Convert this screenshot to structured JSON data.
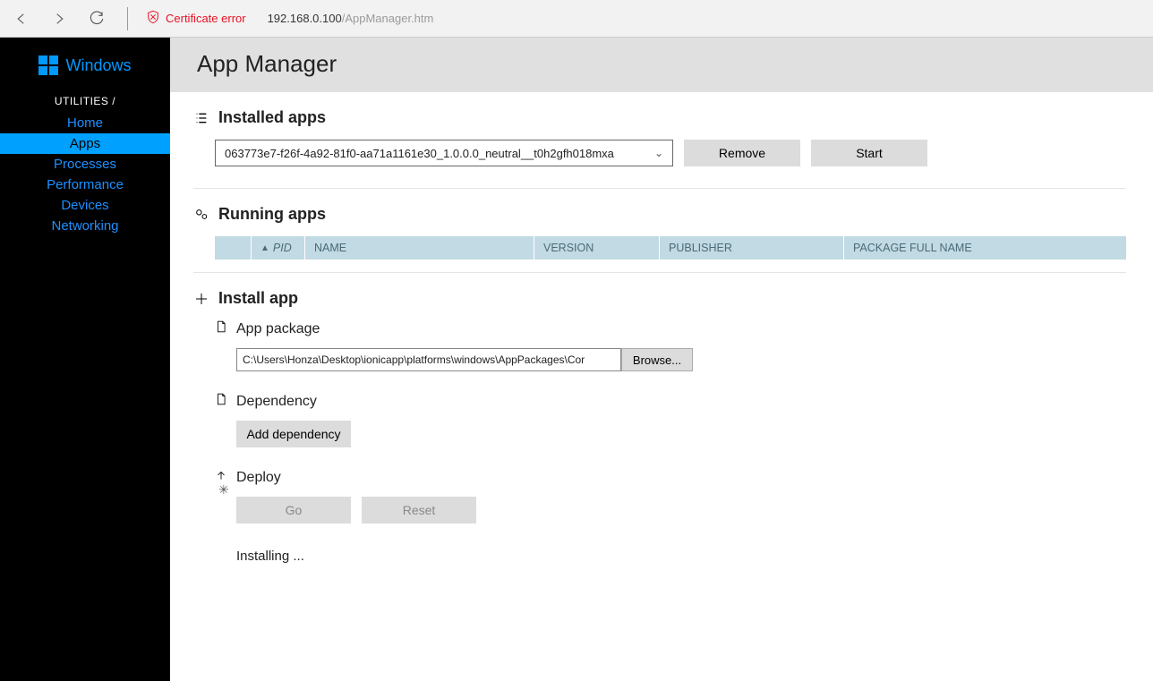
{
  "browser": {
    "cert_error": "Certificate error",
    "url_host": "192.168.0.100",
    "url_path": "/AppManager.htm"
  },
  "sidebar": {
    "logo_text": "Windows",
    "heading": "UTILITIES /",
    "items": [
      {
        "label": "Home"
      },
      {
        "label": "Apps"
      },
      {
        "label": "Processes"
      },
      {
        "label": "Performance"
      },
      {
        "label": "Devices"
      },
      {
        "label": "Networking"
      }
    ]
  },
  "page": {
    "title": "App Manager"
  },
  "installed": {
    "heading": "Installed apps",
    "selected": "063773e7-f26f-4a92-81f0-aa71a1161e30_1.0.0.0_neutral__t0h2gfh018mxa",
    "remove": "Remove",
    "start": "Start"
  },
  "running": {
    "heading": "Running apps",
    "cols": {
      "pid": "PID",
      "name": "NAME",
      "version": "VERSION",
      "publisher": "PUBLISHER",
      "pkg": "PACKAGE FULL NAME"
    }
  },
  "install": {
    "heading": "Install app",
    "app_package": "App package",
    "package_path": "C:\\Users\\Honza\\Desktop\\ionicapp\\platforms\\windows\\AppPackages\\Cor",
    "browse": "Browse...",
    "dependency": "Dependency",
    "add_dependency": "Add dependency",
    "deploy": "Deploy",
    "go": "Go",
    "reset": "Reset",
    "status": "Installing ..."
  }
}
